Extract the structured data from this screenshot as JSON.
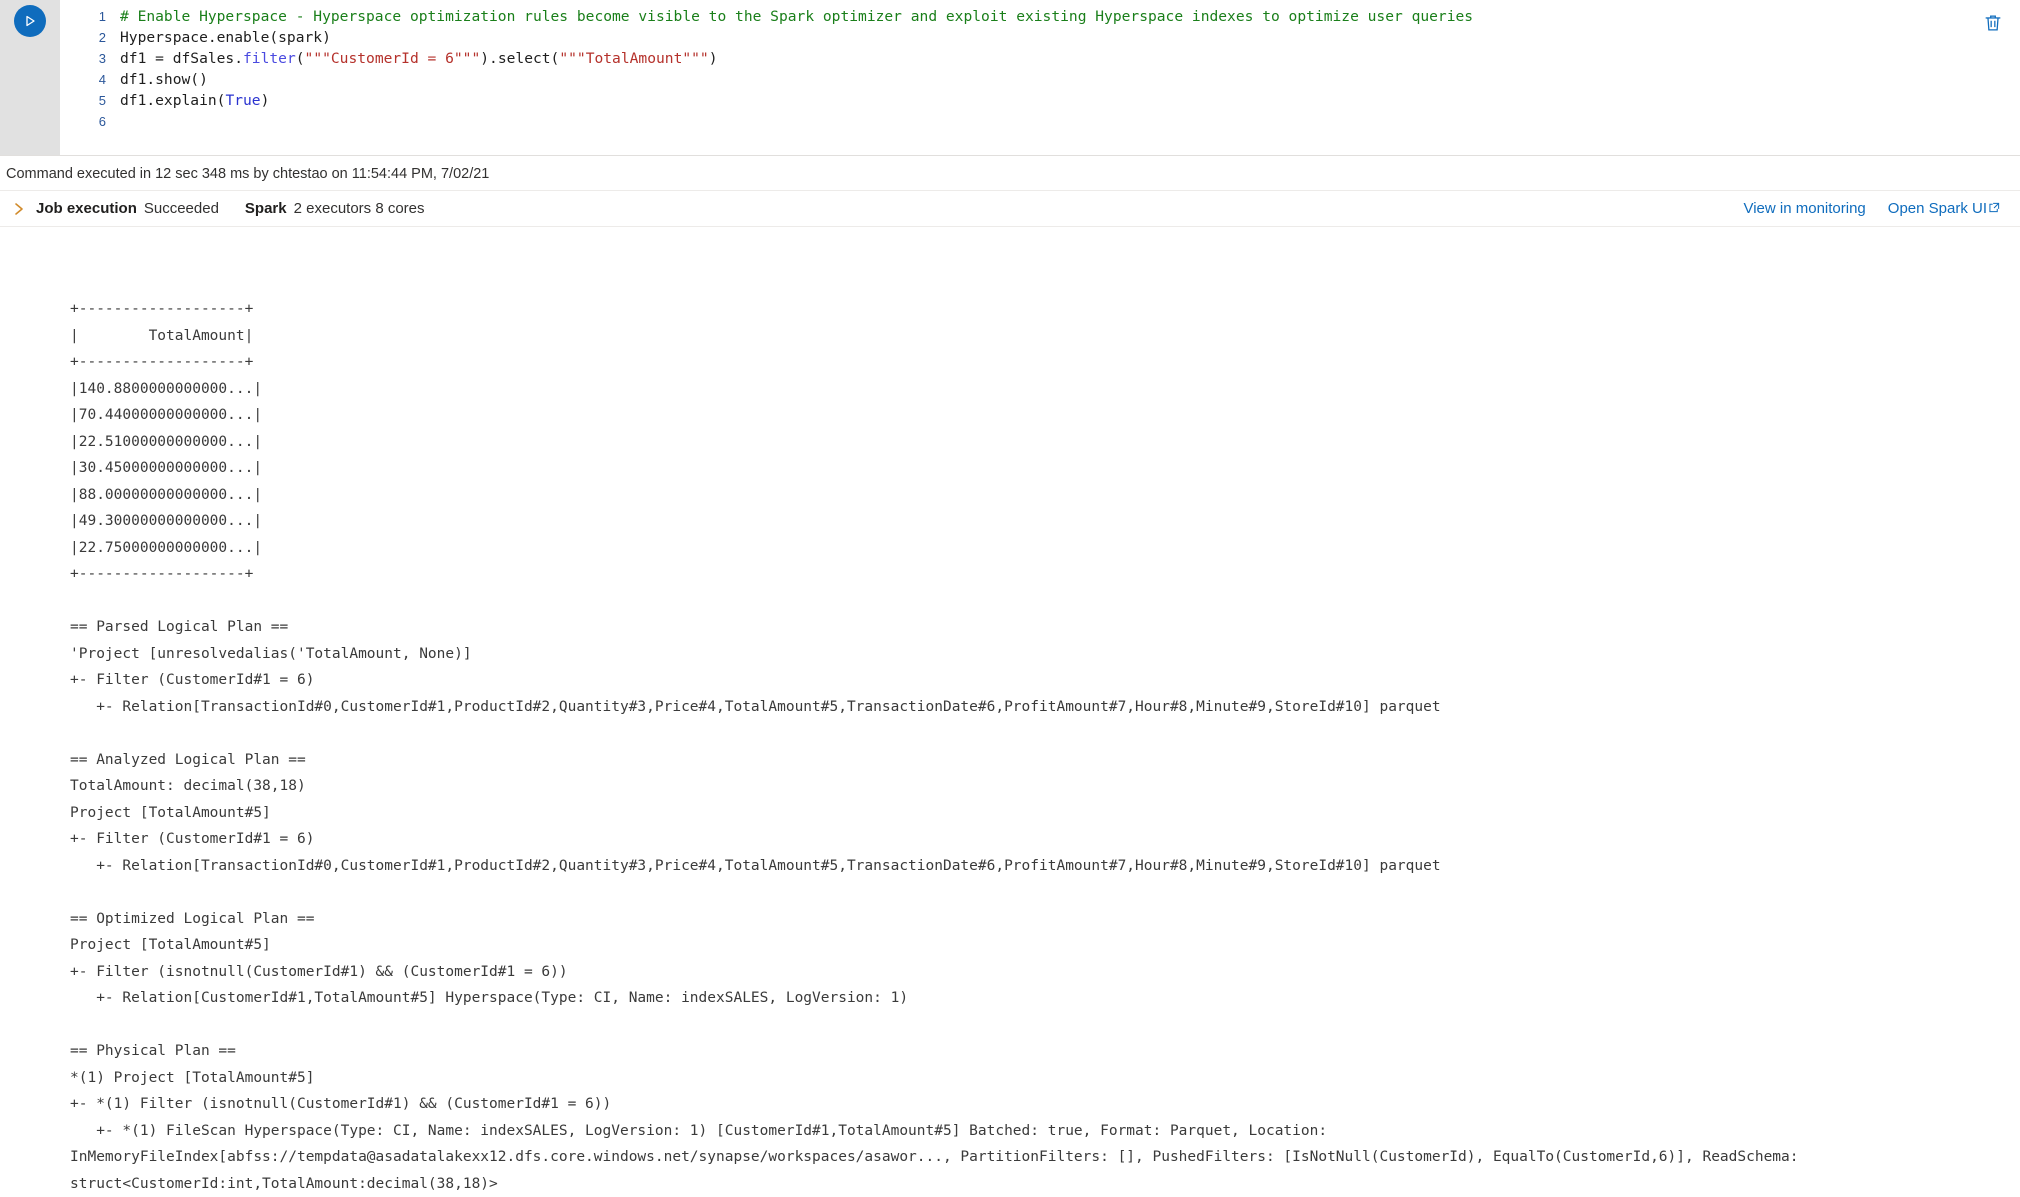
{
  "cell": {
    "run_button_icon": "play-icon",
    "delete_icon": "trash-icon",
    "lines": [
      {
        "no": "1",
        "segments": [
          {
            "cls": "tok-comment",
            "text": "# Enable Hyperspace - Hyperspace optimization rules become visible to the Spark optimizer and exploit existing Hyperspace indexes to optimize user queries"
          }
        ]
      },
      {
        "no": "2",
        "segments": [
          {
            "cls": "",
            "text": "Hyperspace.enable(spark)"
          }
        ]
      },
      {
        "no": "3",
        "segments": [
          {
            "cls": "",
            "text": "df1 = dfSales."
          },
          {
            "cls": "tok-fn",
            "text": "filter"
          },
          {
            "cls": "",
            "text": "("
          },
          {
            "cls": "tok-str",
            "text": "\"\"\"CustomerId = 6\"\"\""
          },
          {
            "cls": "",
            "text": ").select("
          },
          {
            "cls": "tok-str",
            "text": "\"\"\"TotalAmount\"\"\""
          },
          {
            "cls": "",
            "text": ")"
          }
        ]
      },
      {
        "no": "4",
        "segments": [
          {
            "cls": "",
            "text": "df1.show()"
          }
        ]
      },
      {
        "no": "5",
        "segments": [
          {
            "cls": "",
            "text": "df1.explain("
          },
          {
            "cls": "tok-kw",
            "text": "True"
          },
          {
            "cls": "",
            "text": ")"
          }
        ]
      },
      {
        "no": "6",
        "segments": [
          {
            "cls": "",
            "text": ""
          }
        ]
      }
    ]
  },
  "status": {
    "text": "Command executed in 12 sec 348 ms by chtestao on 11:54:44 PM, 7/02/21"
  },
  "job": {
    "chevron_icon": "chevron-right-icon",
    "label": "Job execution",
    "value": "Succeeded",
    "spark_label": "Spark",
    "spark_value": "2 executors 8 cores",
    "links": [
      {
        "label": "View in monitoring",
        "external": false
      },
      {
        "label": "Open Spark UI",
        "external": true,
        "ext_glyph": "↗"
      }
    ]
  },
  "output": {
    "lines": [
      "+-------------------+",
      "|        TotalAmount|",
      "+-------------------+",
      "|140.8800000000000...|",
      "|70.44000000000000...|",
      "|22.51000000000000...|",
      "|30.45000000000000...|",
      "|88.00000000000000...|",
      "|49.30000000000000...|",
      "|22.75000000000000...|",
      "+-------------------+",
      "",
      "== Parsed Logical Plan ==",
      "'Project [unresolvedalias('TotalAmount, None)]",
      "+- Filter (CustomerId#1 = 6)",
      "   +- Relation[TransactionId#0,CustomerId#1,ProductId#2,Quantity#3,Price#4,TotalAmount#5,TransactionDate#6,ProfitAmount#7,Hour#8,Minute#9,StoreId#10] parquet",
      "",
      "== Analyzed Logical Plan ==",
      "TotalAmount: decimal(38,18)",
      "Project [TotalAmount#5]",
      "+- Filter (CustomerId#1 = 6)",
      "   +- Relation[TransactionId#0,CustomerId#1,ProductId#2,Quantity#3,Price#4,TotalAmount#5,TransactionDate#6,ProfitAmount#7,Hour#8,Minute#9,StoreId#10] parquet",
      "",
      "== Optimized Logical Plan ==",
      "Project [TotalAmount#5]",
      "+- Filter (isnotnull(CustomerId#1) && (CustomerId#1 = 6))",
      "   +- Relation[CustomerId#1,TotalAmount#5] Hyperspace(Type: CI, Name: indexSALES, LogVersion: 1)",
      "",
      "== Physical Plan ==",
      "*(1) Project [TotalAmount#5]",
      "+- *(1) Filter (isnotnull(CustomerId#1) && (CustomerId#1 = 6))",
      "   +- *(1) FileScan Hyperspace(Type: CI, Name: indexSALES, LogVersion: 1) [CustomerId#1,TotalAmount#5] Batched: true, Format: Parquet, Location:"
    ],
    "wrapped_tail": "InMemoryFileIndex[abfss://tempdata@asadatalakexx12.dfs.core.windows.net/synapse/workspaces/asawor..., PartitionFilters: [], PushedFilters: [IsNotNull(CustomerId), EqualTo(CustomerId,6)], ReadSchema:\nstruct<CustomerId:int,TotalAmount:decimal(38,18)>"
  },
  "colors": {
    "accent": "#0f6cbd",
    "comment": "#1a7f1a",
    "string": "#b5312b",
    "keyword": "#2a33d0",
    "function": "#4a4ae0",
    "chevron": "#d18b2c",
    "gutter": "#e1e1e1"
  }
}
